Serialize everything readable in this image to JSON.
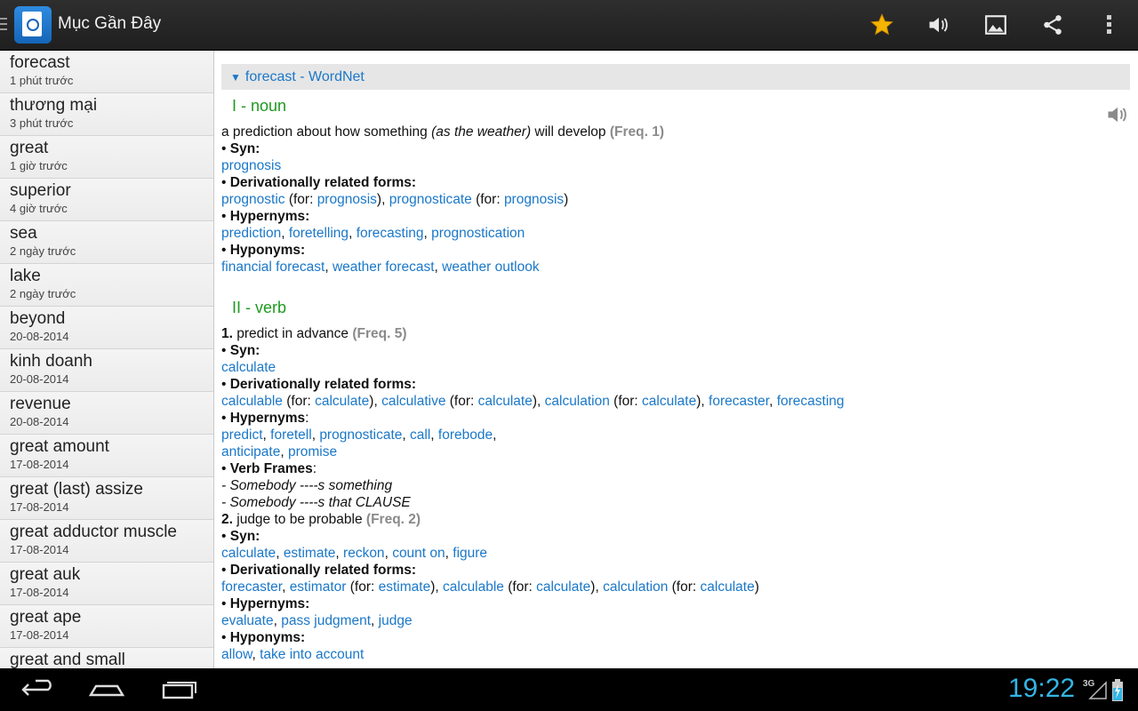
{
  "app": {
    "title": "Mục Gần Đây"
  },
  "toolbar": {
    "actions": [
      {
        "icon": "star-icon",
        "color": "#f4b400"
      },
      {
        "icon": "speaker-icon"
      },
      {
        "icon": "image-icon"
      },
      {
        "icon": "share-icon"
      },
      {
        "icon": "overflow-menu-icon"
      }
    ]
  },
  "history": [
    {
      "word": "forecast",
      "time": "1 phút trước"
    },
    {
      "word": "thương mại",
      "time": "3 phút trước"
    },
    {
      "word": "great",
      "time": "1 giờ trước"
    },
    {
      "word": "superior",
      "time": "4 giờ trước"
    },
    {
      "word": "sea",
      "time": "2 ngày trước"
    },
    {
      "word": "lake",
      "time": "2 ngày trước"
    },
    {
      "word": "beyond",
      "time": "20-08-2014"
    },
    {
      "word": "kinh doanh",
      "time": "20-08-2014"
    },
    {
      "word": "revenue",
      "time": "20-08-2014"
    },
    {
      "word": "great amount",
      "time": "17-08-2014"
    },
    {
      "word": "great (last) assize",
      "time": "17-08-2014"
    },
    {
      "word": "great adductor muscle",
      "time": "17-08-2014"
    },
    {
      "word": "great auk",
      "time": "17-08-2014"
    },
    {
      "word": "great ape",
      "time": "17-08-2014"
    },
    {
      "word": "great and small",
      "time": ""
    }
  ],
  "entry": {
    "header": "forecast - WordNet",
    "noun": {
      "title": "I - noun",
      "definition": "a prediction about how something",
      "definition_italic": "(as the weather)",
      "definition_end": "will develop",
      "freq": "(Freq. 1)",
      "syn_label": "Syn:",
      "syn": "prognosis",
      "deriv_label": "Derivationally related forms:",
      "deriv": [
        {
          "word": "prognostic",
          "for": "prognosis"
        },
        {
          "word": "prognosticate",
          "for": "prognosis"
        }
      ],
      "hyper_label": "Hypernyms:",
      "hyper": [
        "prediction",
        "foretelling",
        "forecasting",
        "prognostication"
      ],
      "hypo_label": "Hyponyms:",
      "hypo": [
        "financial forecast",
        "weather forecast",
        "weather outlook"
      ]
    },
    "verb": {
      "title": "II - verb",
      "sense1": {
        "num": "1.",
        "definition": "predict in advance",
        "freq": "(Freq. 5)",
        "syn_label": "Syn:",
        "syn": "calculate",
        "deriv_label": "Derivationally related forms:",
        "deriv": [
          {
            "word": "calculable",
            "for": "calculate"
          },
          {
            "word": "calculative",
            "for": "calculate"
          },
          {
            "word": "calculation",
            "for": "calculate"
          },
          {
            "word": "forecaster",
            "for": ""
          },
          {
            "word": "forecasting",
            "for": ""
          }
        ],
        "hyper_label": "Hypernyms",
        "hyper_line1": [
          "predict",
          "foretell",
          "prognosticate",
          "call",
          "forebode"
        ],
        "hyper_line2": [
          "anticipate",
          "promise"
        ],
        "frames_label": "Verb Frames",
        "frames": [
          "- Somebody ----s something",
          "- Somebody ----s that CLAUSE"
        ]
      },
      "sense2": {
        "num": "2.",
        "definition": "judge to be probable",
        "freq": "(Freq. 2)",
        "syn_label": "Syn:",
        "syn": [
          "calculate",
          "estimate",
          "reckon",
          "count on",
          "figure"
        ],
        "deriv_label": "Derivationally related forms:",
        "deriv": [
          {
            "word": "forecaster",
            "for": ""
          },
          {
            "word": "estimator",
            "for": "estimate"
          },
          {
            "word": "calculable",
            "for": "calculate"
          },
          {
            "word": "calculation",
            "for": "calculate"
          }
        ],
        "hyper_label": "Hypernyms:",
        "hyper": [
          "evaluate",
          "pass judgment",
          "judge"
        ],
        "hypo_label": "Hyponyms:",
        "hypo": [
          "allow",
          "take into account"
        ]
      }
    }
  },
  "status": {
    "time": "19:22",
    "network": "3G"
  }
}
